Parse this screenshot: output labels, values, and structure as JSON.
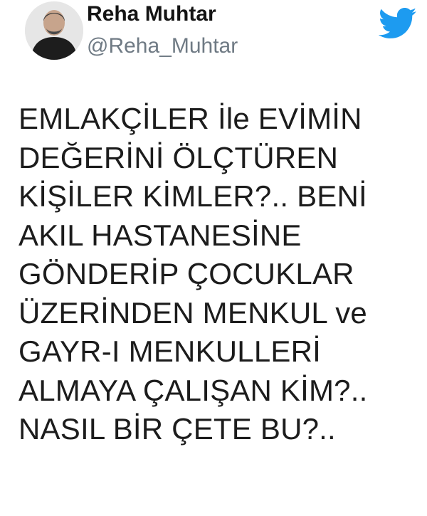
{
  "author": {
    "display_name": "Reha Muhtar",
    "handle": "@Reha_Muhtar",
    "avatar_icon": "profile-photo"
  },
  "brand": {
    "icon": "twitter-bird-icon",
    "color": "#1d9bf0"
  },
  "tweet": {
    "text": "EMLAKÇİLER İle EVİMİN\nDEĞERİNİ ÖLÇTÜREN\nKİŞİLER KİMLER?.. BENİ\nAKIL HASTANESİNE\nGÖNDERİP ÇOCUKLAR\nÜZERİNDEN MENKUL ve\nGAYR-I MENKULLERİ\nALMAYA ÇALIŞAN KİM?..\nNASIL BİR ÇETE BU?.."
  }
}
